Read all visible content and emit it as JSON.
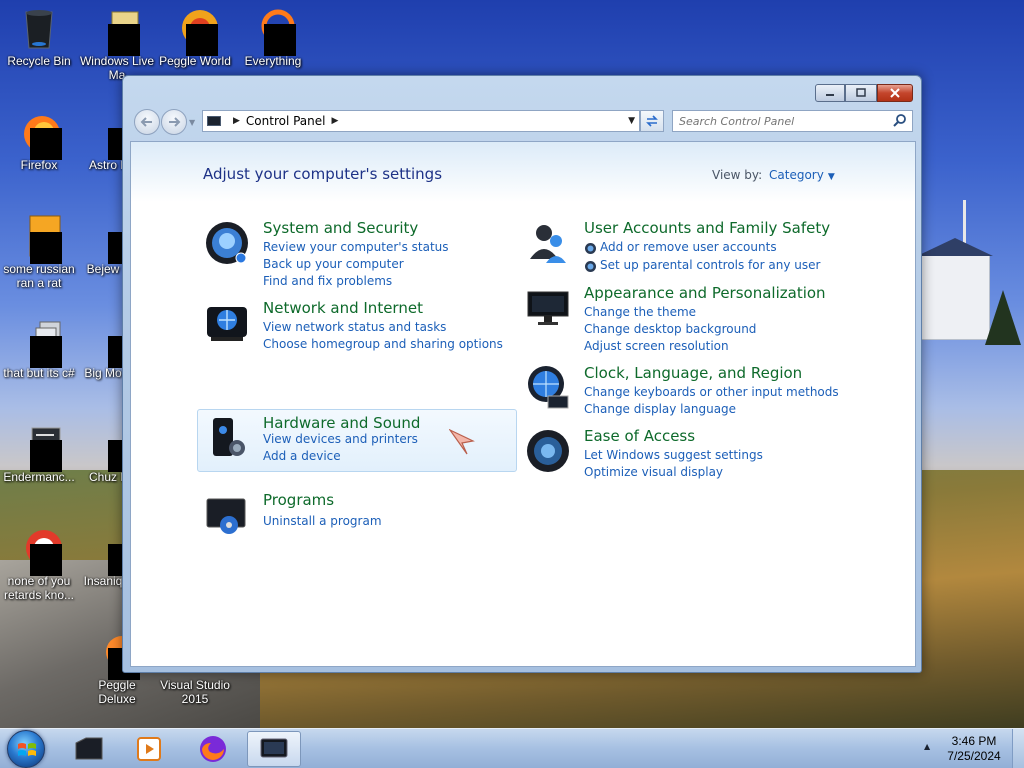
{
  "desktop": {
    "icons": [
      {
        "label": "Recycle Bin"
      },
      {
        "label": "Windows Live Ma"
      },
      {
        "label": "Peggle World"
      },
      {
        "label": "Everything"
      },
      {
        "label": "Firefox"
      },
      {
        "label": "Astro Delu"
      },
      {
        "label": "some russian ran a rat"
      },
      {
        "label": "Bejew Delu"
      },
      {
        "label": "that but its c#"
      },
      {
        "label": "Big Mo Delu"
      },
      {
        "label": "Endermanc..."
      },
      {
        "label": "Chuz Delu"
      },
      {
        "label": "none of you retards kno..."
      },
      {
        "label": "Insaniq Delu"
      },
      {
        "label": "Peggle Deluxe"
      },
      {
        "label": "Visual Studio 2015"
      }
    ]
  },
  "window": {
    "breadcrumb": [
      "Control Panel"
    ],
    "search_placeholder": "Search Control Panel",
    "page_title": "Adjust your computer's settings",
    "view_by_label": "View by:",
    "view_by_value": "Category",
    "categories": [
      {
        "title": "System and Security",
        "links": [
          "Review your computer's status",
          "Back up your computer",
          "Find and fix problems"
        ]
      },
      {
        "title": "Network and Internet",
        "links": [
          "View network status and tasks",
          "Choose homegroup and sharing options"
        ]
      },
      {
        "title": "Hardware and Sound",
        "links": [
          "View devices and printers",
          "Add a device"
        ]
      },
      {
        "title": "Programs",
        "links": [
          "Uninstall a program"
        ]
      },
      {
        "title": "User Accounts and Family Safety",
        "links": [
          "Add or remove user accounts",
          "Set up parental controls for any user"
        ]
      },
      {
        "title": "Appearance and Personalization",
        "links": [
          "Change the theme",
          "Change desktop background",
          "Adjust screen resolution"
        ]
      },
      {
        "title": "Clock, Language, and Region",
        "links": [
          "Change keyboards or other input methods",
          "Change display language"
        ]
      },
      {
        "title": "Ease of Access",
        "links": [
          "Let Windows suggest settings",
          "Optimize visual display"
        ]
      }
    ]
  },
  "taskbar": {
    "clock_time": "3:46 PM",
    "clock_date": "7/25/2024"
  },
  "colors": {
    "category_title": "#0e6a2b",
    "link": "#1c5fb8",
    "page_title": "#1e3287"
  }
}
